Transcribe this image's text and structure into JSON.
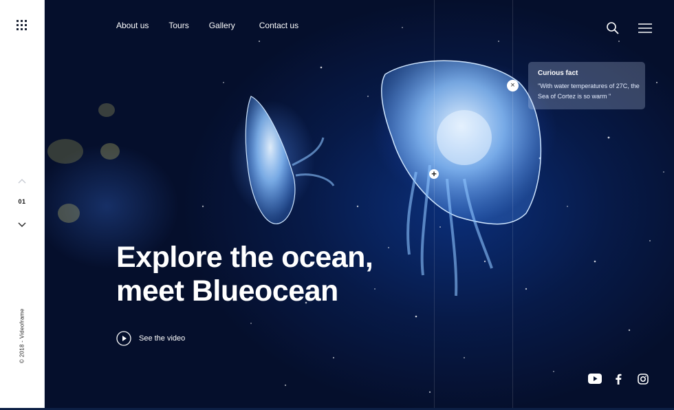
{
  "sidebar": {
    "apps_icon": "grid-dots-icon",
    "slide_number": "01",
    "prev_icon": "chevron-up-icon",
    "next_icon": "chevron-down-icon",
    "copyright": "© 2018 - Videoframe"
  },
  "nav": {
    "items": [
      {
        "label": "About us"
      },
      {
        "label": "Tours"
      },
      {
        "label": "Gallery"
      },
      {
        "label": "Contact us"
      }
    ],
    "search_icon": "search-icon",
    "menu_icon": "hamburger-icon"
  },
  "fact": {
    "title": "Curious fact",
    "text": "\"With water temperatures of 27C, the Sea of Cortez is so warm \"",
    "close_symbol": "×"
  },
  "hotspot": {
    "symbol": "+"
  },
  "hero": {
    "headline_line1": "Explore the ocean,",
    "headline_line2": "meet Blueocean",
    "video_label": "See the video"
  },
  "social": [
    "youtube-icon",
    "facebook-icon",
    "instagram-icon"
  ],
  "colors": {
    "ocean_dark": "#061230",
    "ocean_mid": "#0b2f7a",
    "jelly_glow": "#8ec5ff",
    "sidebar_bg": "#ffffff",
    "text": "#ffffff"
  }
}
